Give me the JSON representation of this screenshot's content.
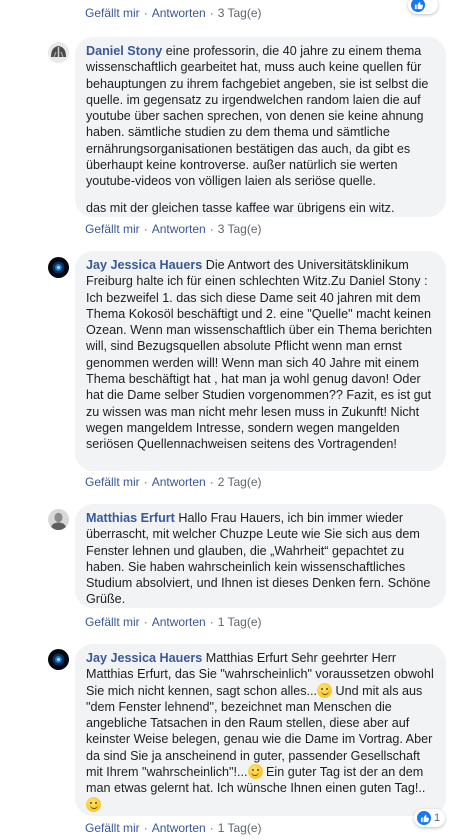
{
  "action_labels": {
    "like": "Gefällt mir",
    "reply": "Antworten",
    "sep": "·"
  },
  "top_actions": {
    "time": "3 Tag(e)"
  },
  "comments": [
    {
      "author": "Daniel Stony",
      "avatar": "helmet-avatar",
      "paragraphs": [
        "eine professorin, die 40 jahre zu einem thema wissenschaftlich gearbeitet hat, muss auch keine quellen für behauptungen zu ihrem fachgebiet angeben, sie ist selbst die quelle. im gegensatz zu irgendwelchen random laien die auf youtube über sachen sprechen, von denen sie keine ahnung haben. sämtliche studien zu dem thema und sämtliche ernährungsorganisationen bestätigen das auch, da gibt es überhaupt keine kontroverse. außer natürlich sie werten youtube-videos von völligen laien als seriöse quelle.",
        "das mit der gleichen tasse kaffee war übrigens ein witz."
      ],
      "time": "3 Tag(e)"
    },
    {
      "author": "Jay Jessica Hauers",
      "avatar": "galaxy-avatar",
      "text": "Die Antwort des Universitätsklinikum Freiburg halte ich für einen schlechten Witz.Zu Daniel Stony : Ich bezweifel 1. das sich diese Dame seit 40 jahren mit dem Thema Kokosöl beschäftigt und 2. eine \"Quelle\" macht keinen Ozean. Wenn man wissenschaftlich über ein Thema berichten will, sind Bezugsquellen absolute Pflicht wenn man ernst genommen werden will! Wenn man sich 40 Jahre mit einem Thema beschäftigt hat , hat man ja wohl genug davon! Oder hat die Dame selber Studien vorgenommen?? Fazit, es ist gut zu wissen was man nicht mehr lesen muss in Zukunft! Nicht wegen mangeldem Intresse, sondern wegen mangelden seriösen Quellennachweisen seitens des Vortragenden!",
      "time": "2 Tag(e)"
    },
    {
      "author": "Matthias Erfurt",
      "avatar": "portrait-avatar",
      "text": "Hallo Frau Hauers, ich bin immer wieder überrascht, mit welcher Chuzpe Leute wie Sie sich aus dem Fenster lehnen und glauben, die „Wahrheit“ gepachtet zu haben. Sie haben wahrscheinlich kein wissenschaftliches Studium absolviert, und Ihnen ist dieses Denken fern. Schöne Grüße.",
      "time": "1 Tag(e)"
    },
    {
      "author": "Jay Jessica Hauers",
      "avatar": "galaxy-avatar",
      "text_parts": [
        "Matthias Erfurt Sehr geehrter Herr Matthias Erfurt, das Sie \"wahrscheinlich\" voraussetzen obwohl Sie mich nicht kennen, sagt schon alles...",
        " Und mit als aus \"dem Fenster lehnend\", bezeichnet man Menschen die angebliche Tatsachen in den Raum stellen, diese aber auf keinster Weise belegen, genau wie die Dame im Vortrag. Aber da sind Sie ja anscheinend in guter, passender Gesellschaft mit Ihrem \"wahrscheinlich\"!...",
        " Ein guter Tag ist der an dem man etwas gelernt hat. Ich wünsche Ihnen einen guten Tag!.."
      ],
      "time": "1 Tag(e)",
      "like_count": "1"
    }
  ],
  "colors": {
    "link": "#385898",
    "bubble": "#f2f3f5",
    "meta": "#606770",
    "like_blue": "#1877f2"
  }
}
